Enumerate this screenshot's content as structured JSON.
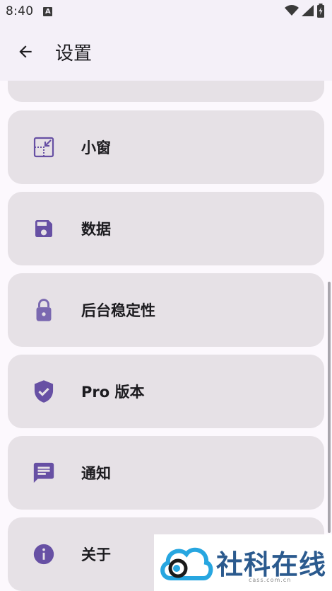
{
  "status_bar": {
    "time": "8:40",
    "notification_glyph": "A"
  },
  "header": {
    "title": "设置"
  },
  "settings": [
    {
      "id": "mini-window",
      "label": "小窗",
      "icon": "picture-in-picture-icon"
    },
    {
      "id": "data",
      "label": "数据",
      "icon": "floppy-disk-icon"
    },
    {
      "id": "background-stability",
      "label": "后台稳定性",
      "icon": "lock-icon"
    },
    {
      "id": "pro",
      "label": "Pro 版本",
      "icon": "verified-shield-icon"
    },
    {
      "id": "notification",
      "label": "通知",
      "icon": "message-icon"
    },
    {
      "id": "about",
      "label": "关于",
      "icon": "info-icon"
    }
  ],
  "colors": {
    "accent": "#6750a4",
    "card_bg": "#e6e1e6",
    "page_bg": "#fcf8fd"
  },
  "watermark": {
    "brand": "社科在线",
    "domain": "cass.com.cn"
  }
}
